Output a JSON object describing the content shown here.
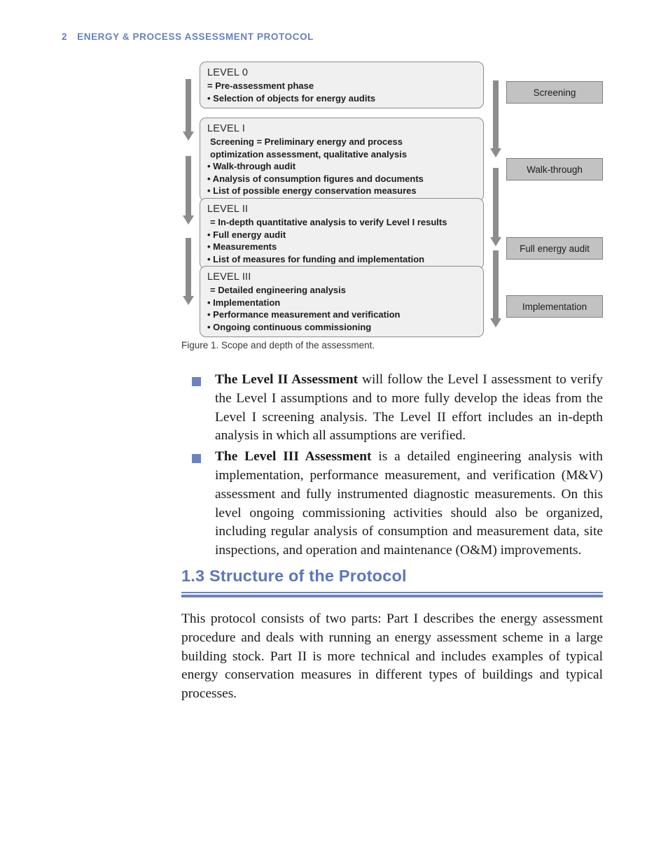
{
  "page": {
    "number": "2",
    "running_head": "ENERGY & PROCESS ASSESSMENT PROTOCOL",
    "accent_color": "#6a82c4",
    "heading_color": "#5b76bd"
  },
  "figure": {
    "caption": "Figure 1. Scope and depth of the assessment.",
    "levels": [
      {
        "title": "LEVEL 0",
        "lines": [
          "= Pre-assessment phase",
          "• Selection of objects for energy audits"
        ]
      },
      {
        "title": "LEVEL I",
        "lines": [
          "Screening = Preliminary energy and process",
          "optimization assessment, qualitative analysis",
          "• Walk-through audit",
          "• Analysis of consumption figures and documents",
          "• List of possible energy conservation measures"
        ]
      },
      {
        "title": "LEVEL II",
        "lines": [
          "= In-depth quantitative analysis to verify Level I results",
          "• Full energy audit",
          "• Measurements",
          "• List of measures for funding and implementation"
        ]
      },
      {
        "title": "LEVEL III",
        "lines": [
          "= Detailed engineering analysis",
          "• Implementation",
          "• Performance measurement and verification",
          "• Ongoing continuous commissioning"
        ]
      }
    ],
    "stages": [
      {
        "label": "Screening"
      },
      {
        "label": "Walk-through"
      },
      {
        "label": "Full energy audit"
      },
      {
        "label": "Implementation"
      }
    ],
    "arrow_color": "#8c8c8c",
    "box_fill": "#f0f0f0",
    "stage_fill": "#c2c2c2"
  },
  "bullets": [
    {
      "lead": "The Level II Assessment",
      "rest": " will follow the Level I assessment to verify the Level I assumptions and to more fully develop the ideas from the Level I screening analysis. The Level II effort includes an in-depth analysis in which all assumptions are verified."
    },
    {
      "lead": "The Level III Assessment",
      "rest": " is a detailed engineering analysis with implementation, performance measurement, and verification (M&V) assessment and fully instrumented diagnostic measurements. On this level ongoing commissioning activities should also be organized, including regular analysis of consumption and measurement data, site inspections, and operation and maintenance (O&M) improvements."
    }
  ],
  "section": {
    "heading": "1.3 Structure of the Protocol",
    "paragraph": "This protocol consists of two parts: Part I describes the energy assessment procedure and deals with running an energy assessment scheme in a large building stock. Part II is more technical and includes examples of typical energy conservation measures in different types of buildings and typical processes."
  }
}
